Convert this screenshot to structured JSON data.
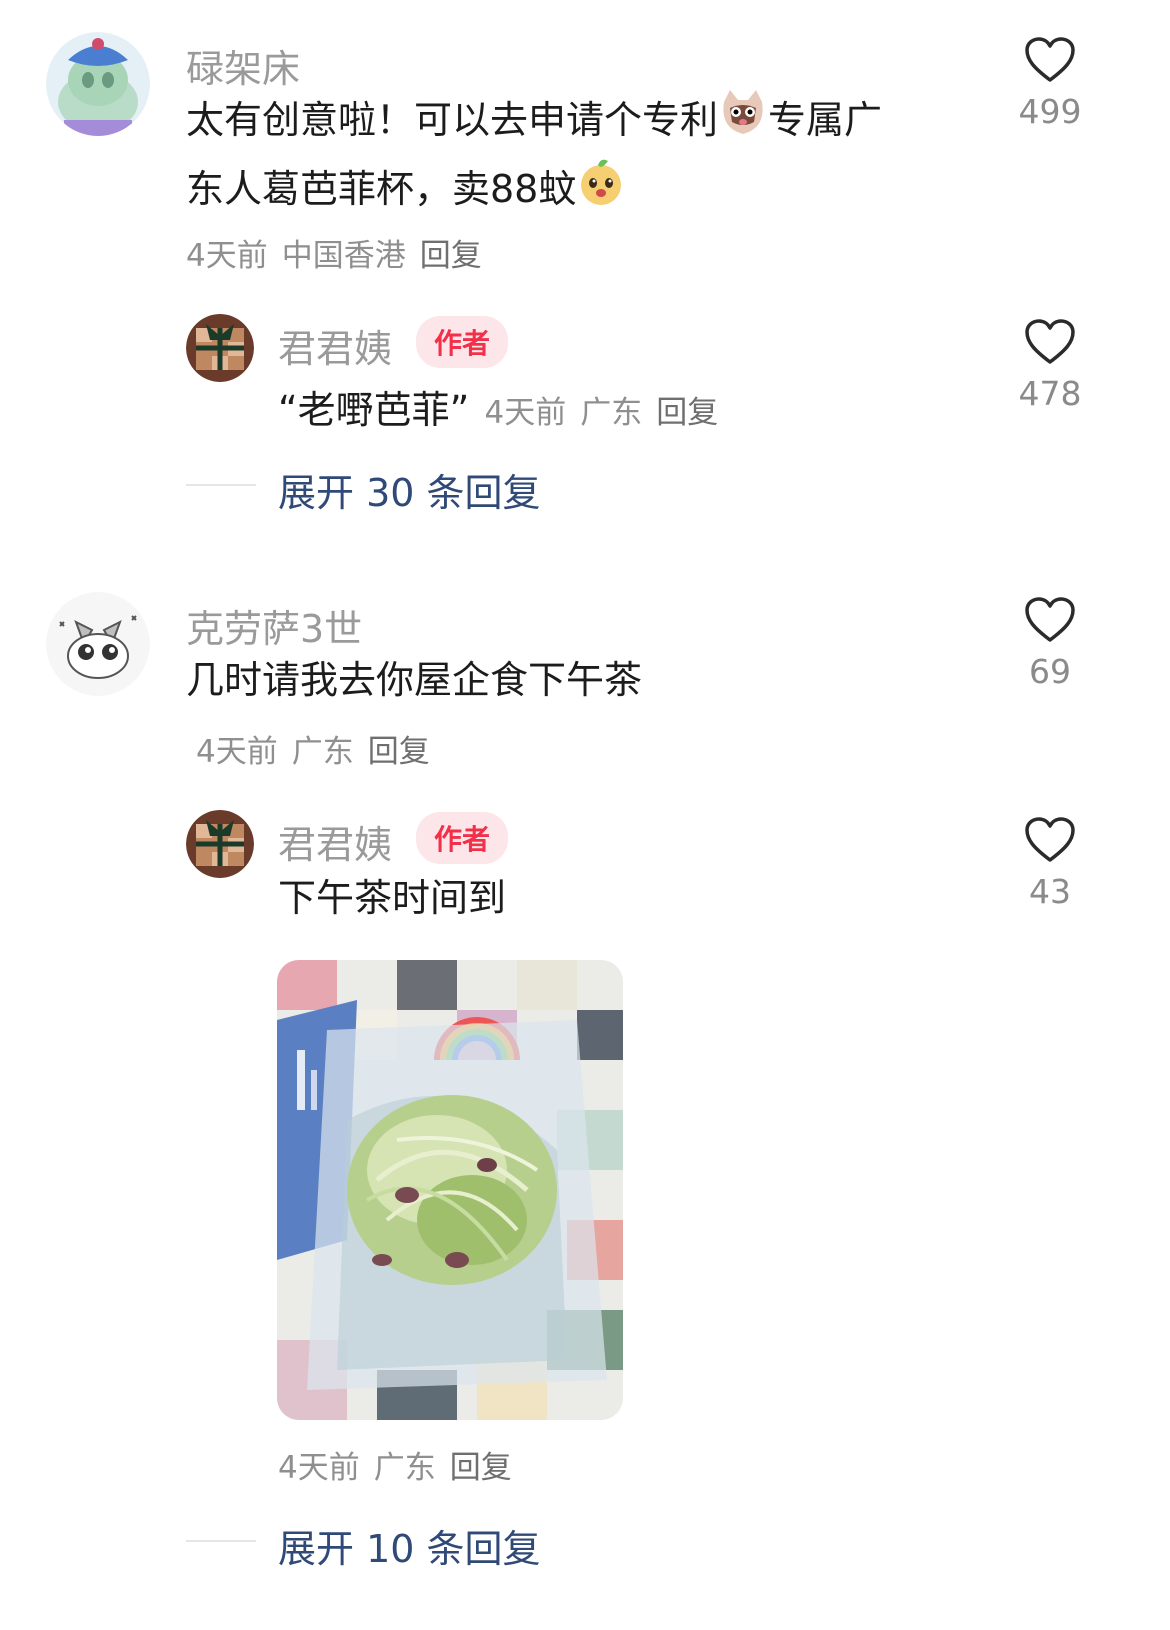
{
  "comments": [
    {
      "username": "碌架床",
      "text_part1": "太有创意啦！可以去申请个专利",
      "text_part2": "专属广",
      "text_part3": "东人葛芭菲杯，卖88蚊",
      "time": "4天前",
      "location": "中国香港",
      "reply_label": "回复",
      "likes": "499",
      "reply": {
        "username": "君君姨",
        "badge": "作者",
        "text": "“老嘢芭菲”",
        "time": "4天前",
        "location": "广东",
        "reply_label": "回复",
        "likes": "478"
      },
      "expand_label": "展开 30 条回复"
    },
    {
      "username": "克劳萨3世",
      "text": "几时请我去你屋企食下午茶",
      "time": "4天前",
      "location": "广东",
      "reply_label": "回复",
      "likes": "69",
      "reply": {
        "username": "君君姨",
        "badge": "作者",
        "text": "下午茶时间到",
        "time": "4天前",
        "location": "广东",
        "reply_label": "回复",
        "likes": "43"
      },
      "expand_label": "展开 10 条回复"
    }
  ],
  "icons": {
    "like": "heart-outline-icon"
  },
  "colors": {
    "author_badge_bg": "#fde6ea",
    "author_badge_text": "#f2304a",
    "expand_link": "#304a78"
  }
}
